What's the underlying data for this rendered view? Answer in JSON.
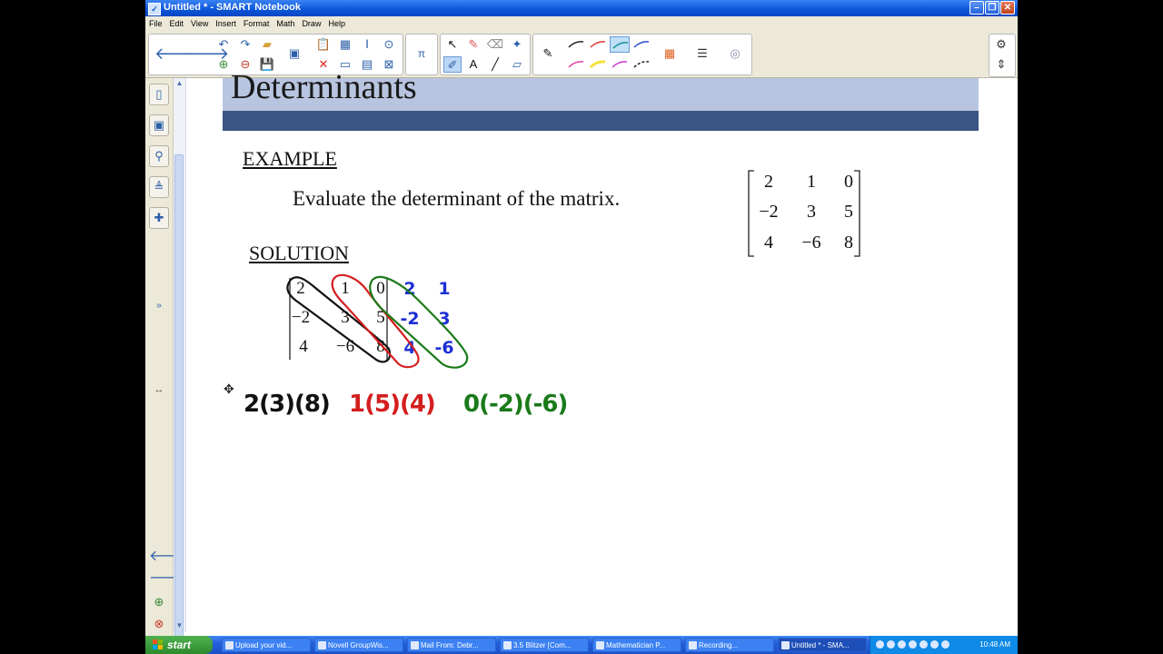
{
  "window": {
    "title": "Untitled * - SMART Notebook"
  },
  "menu": [
    "File",
    "Edit",
    "View",
    "Insert",
    "Format",
    "Math",
    "Draw",
    "Help"
  ],
  "toolbar": {
    "icons": [
      "back-icon",
      "forward-icon",
      "undo-icon",
      "redo-icon",
      "open-folder-icon",
      "screen-share-icon",
      "paste-icon",
      "screenshot-icon",
      "text-tool-icon",
      "zoom-icon",
      "math-pi-icon",
      "select-arrow-icon",
      "pen-icon",
      "eraser-icon",
      "magic-pen-icon",
      "pen-styles-icon",
      "color-palette-icon",
      "properties-icon",
      "gear-icon"
    ]
  },
  "slide": {
    "heading": "Determinants",
    "example_label": "EXAMPLE",
    "prompt": "Evaluate the determinant of the matrix.",
    "solution_label": "SOLUTION"
  },
  "given_matrix": [
    [
      "2",
      "1",
      "0"
    ],
    [
      "−2",
      "3",
      "5"
    ],
    [
      "4",
      "−6",
      "8"
    ]
  ],
  "worked_matrix": [
    [
      "2",
      "1",
      "0"
    ],
    [
      "−2",
      "3",
      "5"
    ],
    [
      "4",
      "−6",
      "8"
    ]
  ],
  "handwritten": {
    "extra_col1": [
      "2",
      "-2",
      "4"
    ],
    "extra_col2": [
      "1",
      "3",
      "-6"
    ],
    "term_black": "2(3)(8)",
    "term_red": "1(5)(4)",
    "term_green": "0(-2)(-6)"
  },
  "colors": {
    "black_loop": "#111111",
    "red_loop": "#d41e1e",
    "green_loop": "#1a7a1a",
    "blue_ink": "#1c2fd6",
    "band_dark": "#3a5583",
    "band_light": "#b8c5e0"
  },
  "taskbar": {
    "start": "start",
    "tasks": [
      "Upload your vid...",
      "Novell GroupWis...",
      "Mail From: Debr...",
      "3.5 Blitzer [Com...",
      "Mathematician P...",
      "Recording...",
      "Untitled * - SMA..."
    ],
    "clock": "10:48 AM"
  }
}
